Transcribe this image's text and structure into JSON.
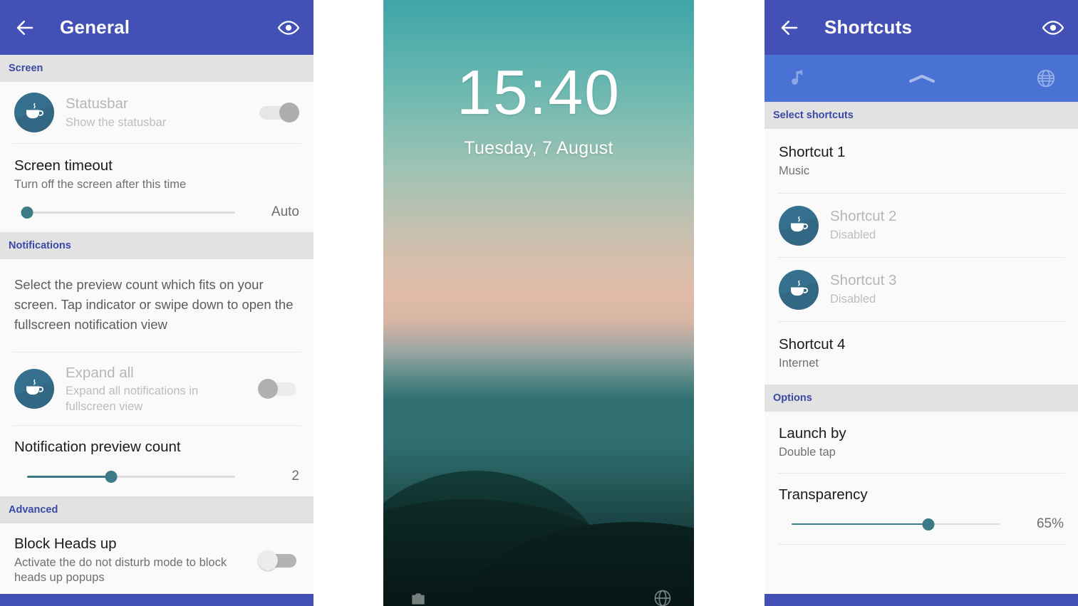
{
  "general_screen": {
    "appbar": {
      "back_icon": "arrow-left-icon",
      "title": "General",
      "action_icon": "eye-icon"
    },
    "sections": [
      {
        "id": "screen",
        "label": "Screen"
      },
      {
        "id": "notifications",
        "label": "Notifications"
      },
      {
        "id": "advanced",
        "label": "Advanced"
      }
    ],
    "statusbar_row": {
      "avatar_icon": "coffee-cup-icon",
      "title": "Statusbar",
      "subtitle": "Show the statusbar",
      "toggle_state": "on-disabled",
      "disabled": true
    },
    "screen_timeout": {
      "title": "Screen timeout",
      "subtitle": "Turn off the screen after this time",
      "slider_value_label": "Auto",
      "slider_percent": 0
    },
    "notifications_info": "Select the preview count which fits on your screen. Tap indicator or swipe down to open the fullscreen notification view",
    "expand_all_row": {
      "avatar_icon": "coffee-cup-icon",
      "title": "Expand all",
      "subtitle": "Expand all notifications in fullscreen view",
      "toggle_state": "off-disabled",
      "disabled": true
    },
    "preview_count": {
      "title": "Notification preview count",
      "slider_value_label": "2",
      "slider_percent": 33
    },
    "block_heads_up": {
      "title": "Block Heads up",
      "subtitle": "Activate the do not disturb mode to block heads up popups",
      "toggle_state": "off"
    }
  },
  "lockscreen": {
    "time": "15:40",
    "date": "Tuesday, 7 August",
    "bottom_left_icon": "camera-icon",
    "bottom_right_icon": "globe-icon"
  },
  "shortcuts_screen": {
    "appbar": {
      "back_icon": "arrow-left-icon",
      "title": "Shortcuts",
      "action_icon": "eye-icon"
    },
    "tabs": [
      {
        "id": "music",
        "icon": "music-note-icon",
        "selected": false
      },
      {
        "id": "arc",
        "icon": "chevron-up-icon",
        "selected": false
      },
      {
        "id": "internet",
        "icon": "globe-icon",
        "selected": false
      }
    ],
    "sections": [
      {
        "id": "select_shortcuts",
        "label": "Select shortcuts"
      },
      {
        "id": "options",
        "label": "Options"
      }
    ],
    "shortcuts": [
      {
        "title": "Shortcut 1",
        "subtitle": "Music",
        "disabled": false,
        "avatar_icon": null
      },
      {
        "title": "Shortcut 2",
        "subtitle": "Disabled",
        "disabled": true,
        "avatar_icon": "coffee-cup-icon"
      },
      {
        "title": "Shortcut 3",
        "subtitle": "Disabled",
        "disabled": true,
        "avatar_icon": "coffee-cup-icon"
      },
      {
        "title": "Shortcut 4",
        "subtitle": "Internet",
        "disabled": false,
        "avatar_icon": null
      }
    ],
    "launch_by": {
      "title": "Launch by",
      "subtitle": "Double tap"
    },
    "transparency": {
      "title": "Transparency",
      "slider_value_label": "65%",
      "slider_percent": 65
    }
  },
  "colors": {
    "appbar_blue": "#4350b5",
    "tabstrip_blue": "#4a72d4",
    "section_header_bg": "#e2e2e2",
    "section_header_text": "#3a49a6",
    "slider_accent": "#3c7b85",
    "avatar_bg": "#36708f",
    "list_bg": "#fafafa"
  }
}
